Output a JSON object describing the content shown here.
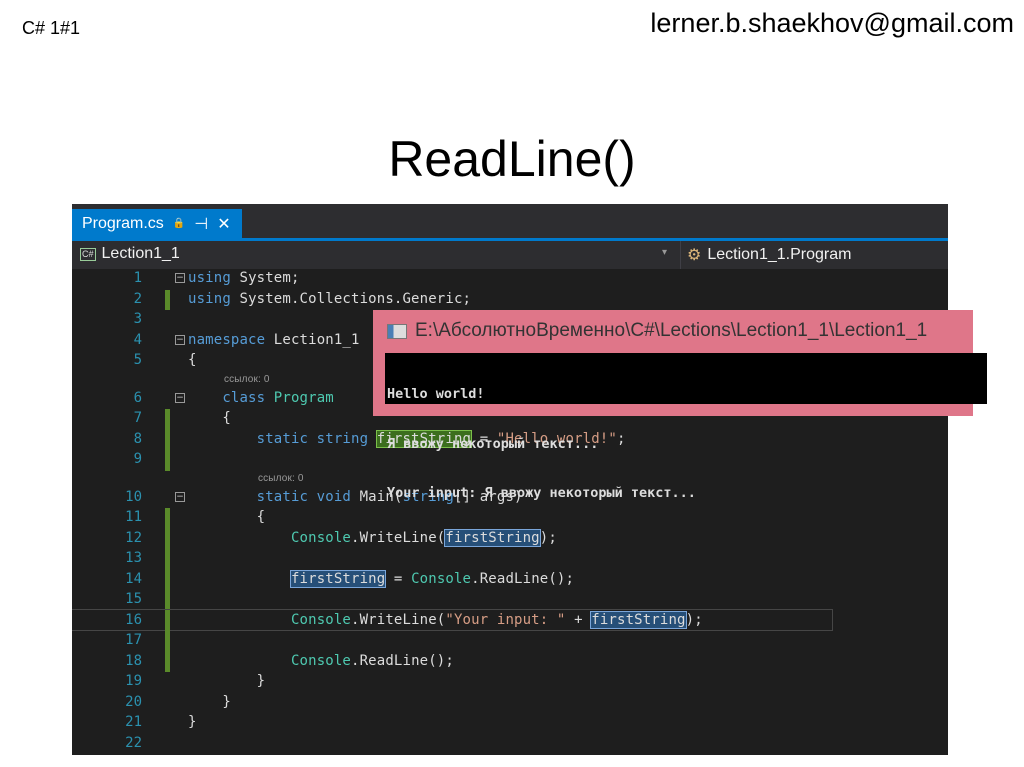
{
  "slide": {
    "course": "C# 1#1",
    "email": "lerner.b.shaekhov@gmail.com",
    "title": "ReadLine()"
  },
  "ide": {
    "tab": {
      "label": "Program.cs",
      "lock": "🔒",
      "pin": "⊣",
      "close": "✕"
    },
    "nav": {
      "project_icon": "C#",
      "project": "Lection1_1",
      "dropdown": "▾",
      "class": "Lection1_1.Program"
    },
    "lines": [
      {
        "n": "1",
        "fold": "−",
        "t": [
          [
            "using",
            "kw"
          ],
          [
            " System;",
            ""
          ]
        ]
      },
      {
        "n": "2",
        "chg": true,
        "t": [
          [
            "using",
            "kw"
          ],
          [
            " System.Collections.Generic;",
            ""
          ]
        ]
      },
      {
        "n": "3",
        "t": []
      },
      {
        "n": "4",
        "fold": "−",
        "t": [
          [
            "namespace",
            "kw"
          ],
          [
            " Lection1_1",
            ""
          ]
        ]
      },
      {
        "n": "5",
        "t": [
          [
            "{",
            ""
          ]
        ]
      },
      {
        "lens": "ссылок: 0",
        "indent": 1
      },
      {
        "n": "6",
        "fold": "−",
        "t": [
          [
            "    class ",
            "kw"
          ],
          [
            "Program",
            "ty"
          ]
        ]
      },
      {
        "n": "7",
        "chg": true,
        "t": [
          [
            "    {",
            ""
          ]
        ]
      },
      {
        "n": "8",
        "chg": true,
        "t": [
          [
            "        static string ",
            "kw"
          ],
          [
            "firstString",
            "hlg"
          ],
          [
            " = ",
            ""
          ],
          [
            "\"Hello world!\"",
            "st"
          ],
          [
            ";",
            ""
          ]
        ]
      },
      {
        "n": "9",
        "chg": true,
        "t": []
      },
      {
        "lens": "ссылок: 0",
        "indent": 2
      },
      {
        "n": "10",
        "fold": "−",
        "t": [
          [
            "        static void ",
            "kw"
          ],
          [
            "Main(",
            ""
          ],
          [
            "string",
            "kw"
          ],
          [
            "[] args)",
            ""
          ]
        ]
      },
      {
        "n": "11",
        "chg": true,
        "t": [
          [
            "        {",
            ""
          ]
        ]
      },
      {
        "n": "12",
        "chg": true,
        "t": [
          [
            "            ",
            ""
          ],
          [
            "Console",
            "ty"
          ],
          [
            ".WriteLine(",
            ""
          ],
          [
            "firstString",
            "hlb"
          ],
          [
            ");",
            ""
          ]
        ]
      },
      {
        "n": "13",
        "chg": true,
        "t": []
      },
      {
        "n": "14",
        "chg": true,
        "t": [
          [
            "            ",
            ""
          ],
          [
            "firstString",
            "hlb"
          ],
          [
            " = ",
            ""
          ],
          [
            "Console",
            "ty"
          ],
          [
            ".ReadLine();",
            ""
          ]
        ]
      },
      {
        "n": "15",
        "chg": true,
        "t": []
      },
      {
        "n": "16",
        "chg": true,
        "cur": true,
        "t": [
          [
            "            ",
            ""
          ],
          [
            "Console",
            "ty"
          ],
          [
            ".WriteLine(",
            ""
          ],
          [
            "\"Your input: \"",
            "st"
          ],
          [
            " + ",
            ""
          ],
          [
            "firstString",
            "hlb"
          ],
          [
            ");",
            ""
          ]
        ]
      },
      {
        "n": "17",
        "chg": true,
        "t": []
      },
      {
        "n": "18",
        "chg": true,
        "t": [
          [
            "            ",
            ""
          ],
          [
            "Console",
            "ty"
          ],
          [
            ".ReadLine();",
            ""
          ]
        ]
      },
      {
        "n": "19",
        "t": [
          [
            "        }",
            ""
          ]
        ]
      },
      {
        "n": "20",
        "t": [
          [
            "    }",
            ""
          ]
        ]
      },
      {
        "n": "21",
        "t": [
          [
            "}",
            ""
          ]
        ]
      },
      {
        "n": "22",
        "t": []
      }
    ]
  },
  "console": {
    "title": "E:\\АбсолютноВременно\\C#\\Lections\\Lection1_1\\Lection1_1",
    "output": [
      "Hello world!",
      "Я ввожу некоторый текст...",
      "Your input: Я ввожу некоторый текст..."
    ]
  },
  "colors": {
    "accent": "#007acc",
    "editor_bg": "#1e1e1e",
    "console_border": "#df7689"
  }
}
